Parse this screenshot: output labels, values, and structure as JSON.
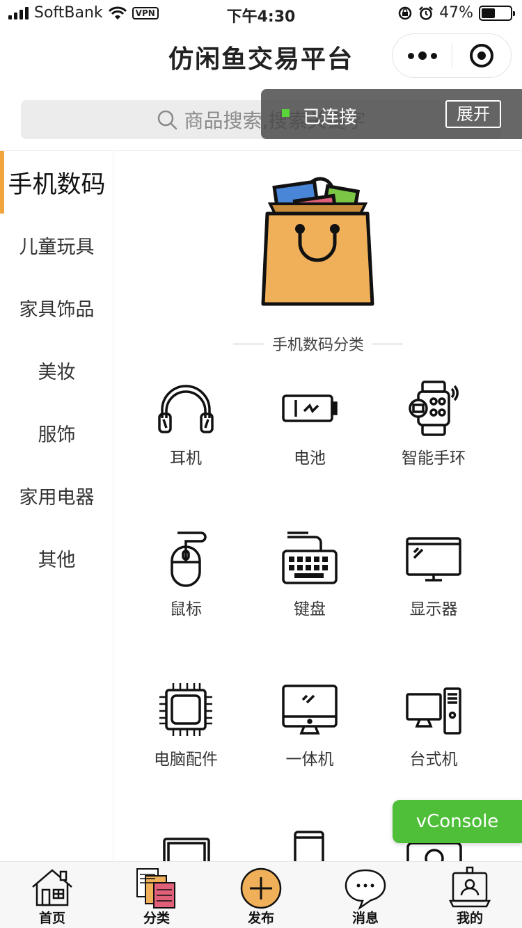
{
  "status_bar": {
    "carrier": "SoftBank",
    "vpn": "VPN",
    "time": "下午4:30",
    "battery": "47%",
    "battery_level": 0.47
  },
  "nav": {
    "title": "仿闲鱼交易平台"
  },
  "search": {
    "placeholder": "商品搜索,搜索关键字"
  },
  "connection": {
    "status": "已连接",
    "expand": "展开"
  },
  "sidebar": {
    "items": [
      {
        "label": "手机数码",
        "active": true
      },
      {
        "label": "儿童玩具"
      },
      {
        "label": "家具饰品"
      },
      {
        "label": "美妆"
      },
      {
        "label": "服饰"
      },
      {
        "label": "家用电器"
      },
      {
        "label": "其他"
      }
    ]
  },
  "main": {
    "section_title": "手机数码分类",
    "categories": [
      {
        "label": "耳机",
        "icon": "headphones-icon"
      },
      {
        "label": "电池",
        "icon": "battery-icon"
      },
      {
        "label": "智能手环",
        "icon": "smartwatch-icon"
      },
      {
        "label": "鼠标",
        "icon": "mouse-icon"
      },
      {
        "label": "键盘",
        "icon": "keyboard-icon"
      },
      {
        "label": "显示器",
        "icon": "monitor-icon"
      },
      {
        "label": "电脑配件",
        "icon": "cpu-chip-icon"
      },
      {
        "label": "一体机",
        "icon": "all-in-one-pc-icon"
      },
      {
        "label": "台式机",
        "icon": "desktop-pc-icon"
      }
    ]
  },
  "vconsole": {
    "label": "vConsole"
  },
  "tabbar": {
    "items": [
      {
        "label": "首页",
        "icon": "home-icon"
      },
      {
        "label": "分类",
        "icon": "category-icon"
      },
      {
        "label": "发布",
        "icon": "publish-plus-icon"
      },
      {
        "label": "消息",
        "icon": "message-bubble-icon"
      },
      {
        "label": "我的",
        "icon": "profile-icon"
      }
    ]
  },
  "colors": {
    "accent": "#f0a53c",
    "console_green": "#4fbf3a",
    "connected_dot": "#5ad53a",
    "bag_orange": "#f0b05a"
  }
}
